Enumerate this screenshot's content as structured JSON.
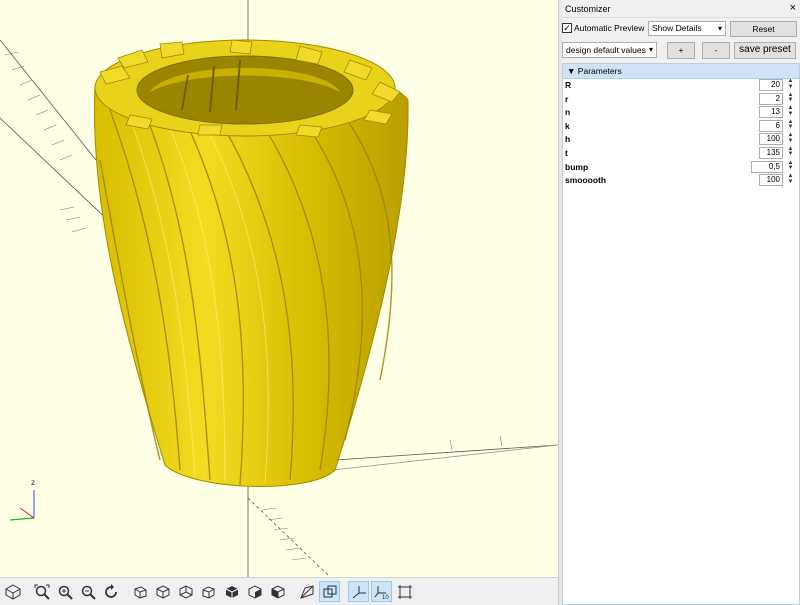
{
  "customizer": {
    "title": "Customizer",
    "close": "×",
    "automatic_preview_label": "Automatic Preview",
    "automatic_preview_checked": true,
    "show_details": "Show Details",
    "reset_label": "Reset",
    "preset_select": "design default values",
    "add_label": "+",
    "remove_label": "-",
    "save_preset_label": "save preset",
    "section_title": "Parameters",
    "params": [
      {
        "name": "R",
        "value": "20"
      },
      {
        "name": "r",
        "value": "2"
      },
      {
        "name": "n",
        "value": "13"
      },
      {
        "name": "k",
        "value": "6"
      },
      {
        "name": "h",
        "value": "100"
      },
      {
        "name": "t",
        "value": "135"
      },
      {
        "name": "bump",
        "value": "0,5"
      },
      {
        "name": "smooooth",
        "value": "100"
      }
    ]
  },
  "viewport": {
    "axis_label": "z",
    "background": "#ffffe5",
    "model_color": "#e6d00b"
  },
  "toolbar": {
    "buttons": [
      "render-icon",
      "view-all-icon",
      "zoom-in-icon",
      "zoom-out-icon",
      "reset-view-icon",
      "view-right-icon",
      "view-top-icon",
      "view-bottom-icon",
      "view-left-icon",
      "view-front-icon",
      "view-back-icon",
      "view-diagonal-icon",
      "perspective-icon",
      "show-axes-icon",
      "show-scale-icon",
      "show-edges-icon"
    ]
  }
}
